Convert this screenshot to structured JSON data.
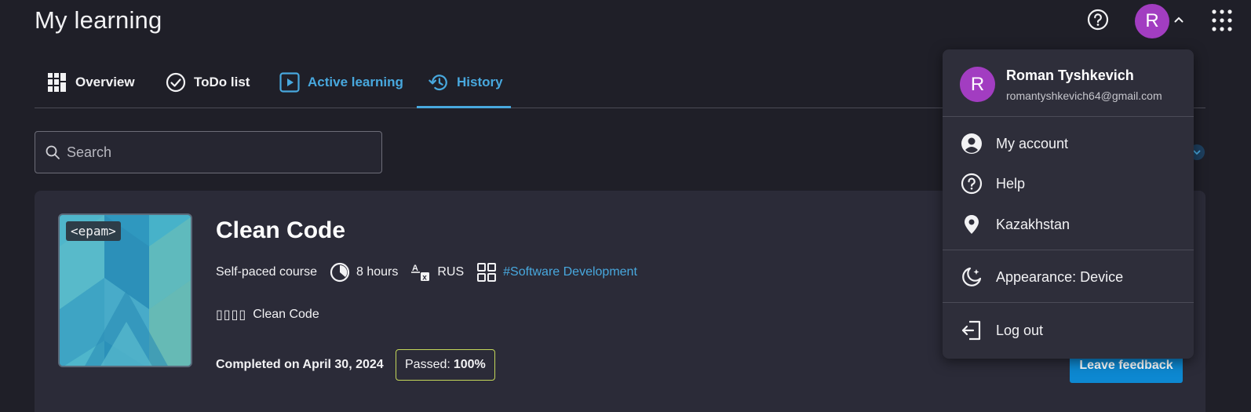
{
  "header": {
    "title": "My learning",
    "avatar_letter": "R"
  },
  "tabs": [
    {
      "label": "Overview",
      "icon": "grid-dashboard-icon",
      "color": "#f2f2f4"
    },
    {
      "label": "ToDo list",
      "icon": "check-circle-icon",
      "color": "#f2f2f4"
    },
    {
      "label": "Active learning",
      "icon": "play-square-icon",
      "color": "#48a8de"
    },
    {
      "label": "History",
      "icon": "history-icon",
      "color": "#48a8de",
      "active": true
    }
  ],
  "search": {
    "placeholder": "Search",
    "value": ""
  },
  "course": {
    "badge": "<epam>",
    "title": "Clean Code",
    "type": "Self-paced course",
    "duration": "8 hours",
    "language": "RUS",
    "tag": "#Software Development",
    "subtitle_glyphs": "▯▯▯▯",
    "subtitle": "Clean Code",
    "completed": "Completed on April 30, 2024",
    "passed_label": "Passed:",
    "passed_value": "100%",
    "feedback_button": "Leave feedback"
  },
  "account_menu": {
    "avatar_letter": "R",
    "name": "Roman Tyshkevich",
    "email": "romantyshkevich64@gmail.com",
    "items": [
      {
        "label": "My account",
        "icon": "account-circle-icon"
      },
      {
        "label": "Help",
        "icon": "help-circle-icon"
      },
      {
        "label": "Kazakhstan",
        "icon": "location-pin-icon"
      },
      {
        "label": "Appearance: Device",
        "icon": "moon-icon"
      },
      {
        "label": "Log out",
        "icon": "logout-icon"
      }
    ]
  },
  "colors": {
    "accent": "#48a8de",
    "button": "#0d88d1",
    "avatar": "#a23dc1",
    "passed_border": "#c4d75a",
    "background": "#1f1f28",
    "card": "#2b2b38"
  }
}
